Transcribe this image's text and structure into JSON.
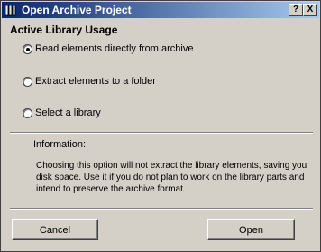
{
  "window": {
    "title": "Open Archive Project",
    "help_label": "?",
    "close_label": "X"
  },
  "section": {
    "heading": "Active Library Usage"
  },
  "options": [
    {
      "label": "Read elements directly from archive",
      "selected": true
    },
    {
      "label": "Extract elements to a folder",
      "selected": false
    },
    {
      "label": "Select a library",
      "selected": false
    }
  ],
  "info": {
    "title": "Information:",
    "text": "Choosing this option will not extract the library elements, saving you disk space. Use it if you do not plan to work on the library parts and intend to preserve the archive format."
  },
  "buttons": {
    "cancel": "Cancel",
    "open": "Open"
  },
  "colors": {
    "titlebar_start": "#0a246a",
    "titlebar_end": "#a6caf0",
    "dialog_bg": "#d4d0c8"
  }
}
